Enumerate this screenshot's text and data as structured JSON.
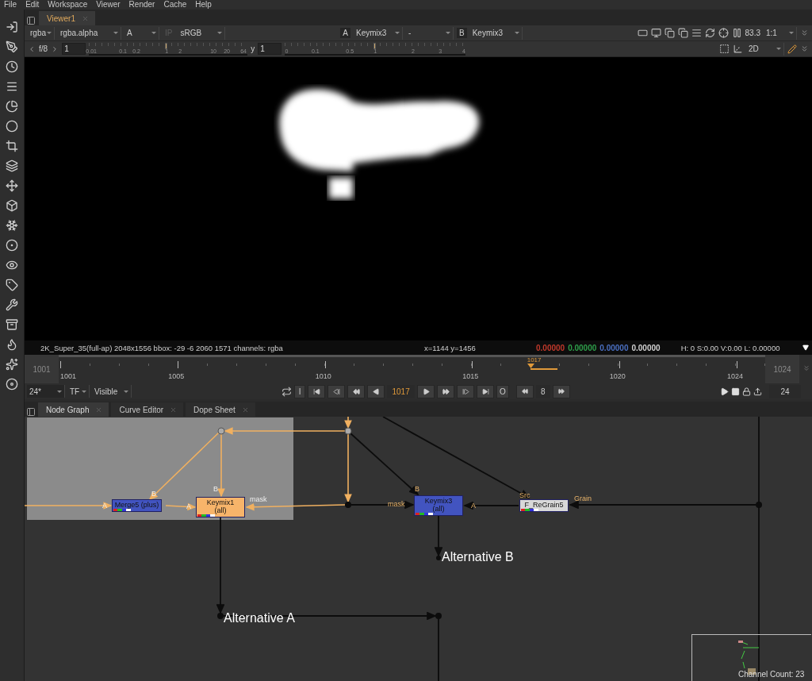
{
  "menu": [
    "File",
    "Edit",
    "Workspace",
    "Viewer",
    "Render",
    "Cache",
    "Help"
  ],
  "viewer_tabs": [
    {
      "label": "Viewer1",
      "selected": true
    }
  ],
  "viewer_toolbar": {
    "channels": "rgba",
    "layer": "rgba.alpha",
    "alpha": "A",
    "ip": "IP",
    "colorspace": "sRGB",
    "input_a": {
      "letter": "A",
      "node": "Keymix3"
    },
    "compare": "-",
    "input_b": {
      "letter": "B",
      "node": "Keymix3"
    },
    "zoom": "83.3",
    "proxy": "1:1"
  },
  "exposure": {
    "label": "f/8",
    "value": "1",
    "level": 0.49,
    "ticks": [
      "0.01",
      "0.1",
      "0.2",
      "1",
      "2",
      "10",
      "20",
      "64"
    ]
  },
  "gamma": {
    "label": "y",
    "value": "1",
    "level": 0.5,
    "ticks": [
      "0",
      "0.1",
      "0.5",
      "1",
      "2",
      "3",
      "4"
    ]
  },
  "view_mode": "2D",
  "info_bar": {
    "format": "2K_Super_35(full-ap) 2048x1556  bbox: -29 -6 2060 1571 channels: rgba",
    "position": "x=1144 y=1456",
    "pixel": [
      {
        "value": "0.00000",
        "color": "#c0392b"
      },
      {
        "value": "0.00000",
        "color": "#2e9e4a"
      },
      {
        "value": "0.00000",
        "color": "#4a6fc0"
      },
      {
        "value": "0.00000",
        "color": "#d0d0d0"
      }
    ],
    "hsvl": "H:  0 S:0.00 V:0.00  L: 0.00000"
  },
  "timeline": {
    "in": "1001",
    "out": "1024",
    "current": "1017",
    "level": 0.696,
    "ticks": [
      "1001",
      "1005",
      "1010",
      "1015",
      "1020",
      "1024"
    ]
  },
  "playback": {
    "fps": "24*",
    "time_format": "TF",
    "range": "Visible",
    "in_button": "I",
    "frame": "1017",
    "out_button": "O",
    "increment": "8",
    "flipbook_fps": "24"
  },
  "graph_tabs": [
    {
      "label": "Node Graph",
      "selected": true
    },
    {
      "label": "Curve Editor",
      "selected": false
    },
    {
      "label": "Dope Sheet",
      "selected": false
    }
  ],
  "nodes": [
    {
      "lines": [
        "Merge5 (plus)"
      ],
      "color": "#4254c0"
    },
    {
      "lines": [
        "Keymix1",
        "(all)"
      ],
      "color": "#f7b46a"
    },
    {
      "lines": [
        "Keymix3",
        "(all)"
      ],
      "color": "#4254c0"
    },
    {
      "lines": [
        "F_ReGrain5"
      ],
      "color": "#d8d8d8"
    }
  ],
  "input_labels": [
    "A",
    "B",
    "A",
    "B",
    "mask",
    "mask",
    "B",
    "A",
    "Src",
    "Grain"
  ],
  "notes": [
    "Alternative B",
    "Alternative A"
  ],
  "status": "Channel Count: 23"
}
